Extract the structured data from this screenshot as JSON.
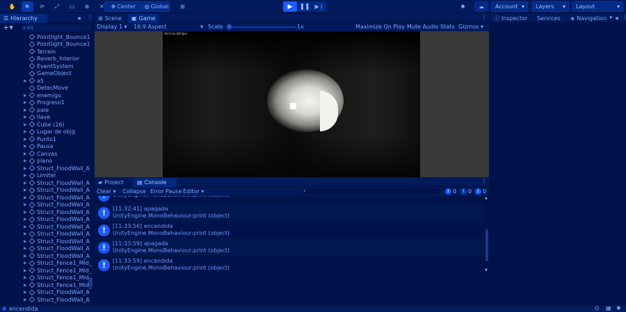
{
  "toolbar": {
    "tools": [
      {
        "name": "hand-tool-icon",
        "glyph": "✋",
        "active": false
      },
      {
        "name": "move-tool-icon",
        "glyph": "✥",
        "active": true
      },
      {
        "name": "rotate-tool-icon",
        "glyph": "⟳",
        "active": false
      },
      {
        "name": "scale-tool-icon",
        "glyph": "⤢",
        "active": false
      },
      {
        "name": "rect-tool-icon",
        "glyph": "▭",
        "active": false
      },
      {
        "name": "transform-tool-icon",
        "glyph": "⊕",
        "active": false
      },
      {
        "name": "custom-tool-icon",
        "glyph": "✕",
        "active": false
      }
    ],
    "pivot_center": "Center",
    "pivot_global": "Global",
    "account_label": "Account",
    "layers_label": "Layers",
    "layout_label": "Layout"
  },
  "hierarchy": {
    "tab": "Hierarchy",
    "search_placeholder": "All",
    "items": [
      {
        "label": "Pointlight_Bounce1",
        "expandable": false
      },
      {
        "label": "Pointlight_Bounce1",
        "expandable": false
      },
      {
        "label": "Terrain",
        "expandable": false
      },
      {
        "label": "Reverb_Interior",
        "expandable": false
      },
      {
        "label": "EventSystem",
        "expandable": false
      },
      {
        "label": "GameObject",
        "expandable": false
      },
      {
        "label": "a5",
        "expandable": true
      },
      {
        "label": "DetecMove",
        "expandable": false
      },
      {
        "label": "enemigo",
        "expandable": true
      },
      {
        "label": "Progreso1",
        "expandable": true
      },
      {
        "label": "pale",
        "expandable": true
      },
      {
        "label": "llave",
        "expandable": true
      },
      {
        "label": "Cube (16)",
        "expandable": true
      },
      {
        "label": "Lugar de objg",
        "expandable": true
      },
      {
        "label": "Punto1",
        "expandable": true
      },
      {
        "label": "Pausa",
        "expandable": true
      },
      {
        "label": "Canvas",
        "expandable": true
      },
      {
        "label": "plano",
        "expandable": true
      },
      {
        "label": "Struct_FloodWall_A",
        "expandable": true
      },
      {
        "label": "Limitel",
        "expandable": true
      },
      {
        "label": "Struct_FloodWall_A",
        "expandable": true
      },
      {
        "label": "Struct_FloodWall_A",
        "expandable": true
      },
      {
        "label": "Struct_FloodWall_A",
        "expandable": true
      },
      {
        "label": "Struct_FloodWall_A",
        "expandable": true
      },
      {
        "label": "Struct_FloodWall_A",
        "expandable": true
      },
      {
        "label": "Struct_FloodWall_A",
        "expandable": true
      },
      {
        "label": "Struct_FloodWall_A",
        "expandable": true
      },
      {
        "label": "Struct_FloodWall_A",
        "expandable": true
      },
      {
        "label": "Struct_FloodWall_A",
        "expandable": true
      },
      {
        "label": "Struct_FloodWall_A",
        "expandable": true
      },
      {
        "label": "Struct_FloodWall_A",
        "expandable": true
      },
      {
        "label": "Struct_Fence1_Mid_",
        "expandable": true
      },
      {
        "label": "Struct_Fence1_Mid_",
        "expandable": true
      },
      {
        "label": "Struct_Fence1_Mid_",
        "expandable": true
      },
      {
        "label": "Struct_Fence1_Mid_",
        "expandable": true
      },
      {
        "label": "Struct_FloodWall_A",
        "expandable": true
      },
      {
        "label": "Struct_FloodWall_A",
        "expandable": true
      }
    ]
  },
  "scene_tabs": {
    "scene": "Scene",
    "game": "Game"
  },
  "game_bar": {
    "display": "Display 1",
    "aspect": "16:9 Aspect",
    "scale_label": "Scale",
    "scale_value": "1x",
    "maximize": "Maximize On Play",
    "mute": "Mute Audio",
    "stats": "Stats",
    "gizmos": "Gizmos",
    "frame_stats": "16.0 ms (60 fps)"
  },
  "bottom_tabs": {
    "project": "Project",
    "console": "Console"
  },
  "console_bar": {
    "clear": "Clear",
    "collapse": "Collapse",
    "error_pause": "Error Pause",
    "editor": "Editor",
    "count_info": "0",
    "count_warn": "0",
    "count_error": "0"
  },
  "console_logs": [
    {
      "time": "",
      "msg": "",
      "trace": "UnityEngine.MonoBehaviour:print (object)"
    },
    {
      "time": "[11:32:41]",
      "msg": "apagada",
      "trace": "UnityEngine.MonoBehaviour:print (object)"
    },
    {
      "time": "[11:33:56]",
      "msg": "encendida",
      "trace": "UnityEngine.MonoBehaviour:print (object)"
    },
    {
      "time": "[11:33:59]",
      "msg": "apagada",
      "trace": "UnityEngine.MonoBehaviour:print (object)"
    },
    {
      "time": "[11:33:59]",
      "msg": "encendida",
      "trace": "UnityEngine.MonoBehaviour:print (object)"
    }
  ],
  "right_tabs": {
    "inspector": "Inspector",
    "services": "Services",
    "navigation": "Navigation"
  },
  "status_bar": {
    "message": "encendida"
  }
}
